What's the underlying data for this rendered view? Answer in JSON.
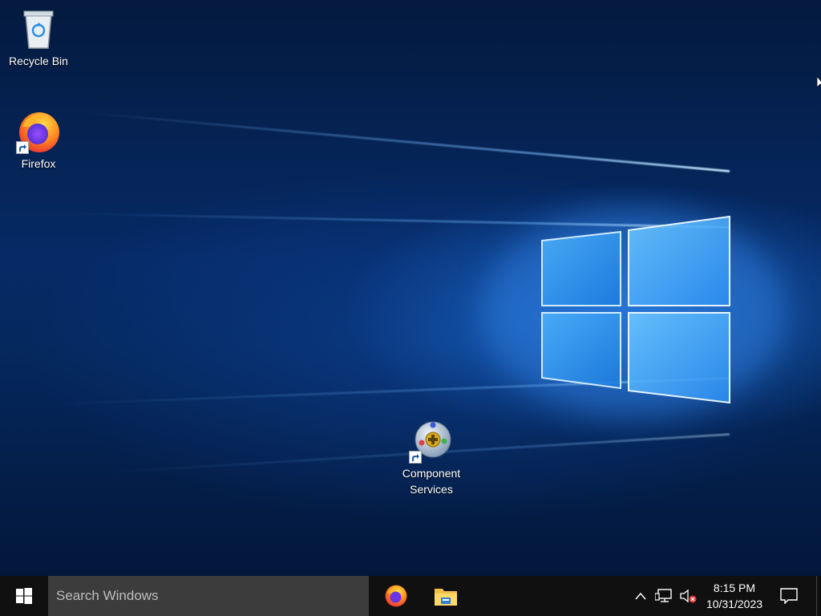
{
  "desktop": {
    "icons": [
      {
        "label": "Recycle Bin"
      },
      {
        "label": "Firefox"
      },
      {
        "label_line1": "Component",
        "label_line2": "Services"
      }
    ]
  },
  "taskbar": {
    "search_placeholder": "Search Windows",
    "pinned_apps": [
      "firefox-icon",
      "file-explorer-icon"
    ],
    "tray_icons": [
      "chevron-up-icon",
      "network-icon",
      "volume-muted-icon",
      "notification-icon"
    ]
  },
  "clock": {
    "time": "8:15 PM",
    "date": "10/31/2023"
  },
  "colors": {
    "taskbar": "#101010",
    "search_box": "#3c3c3c",
    "wallpaper_accent": "#1e8cff"
  }
}
